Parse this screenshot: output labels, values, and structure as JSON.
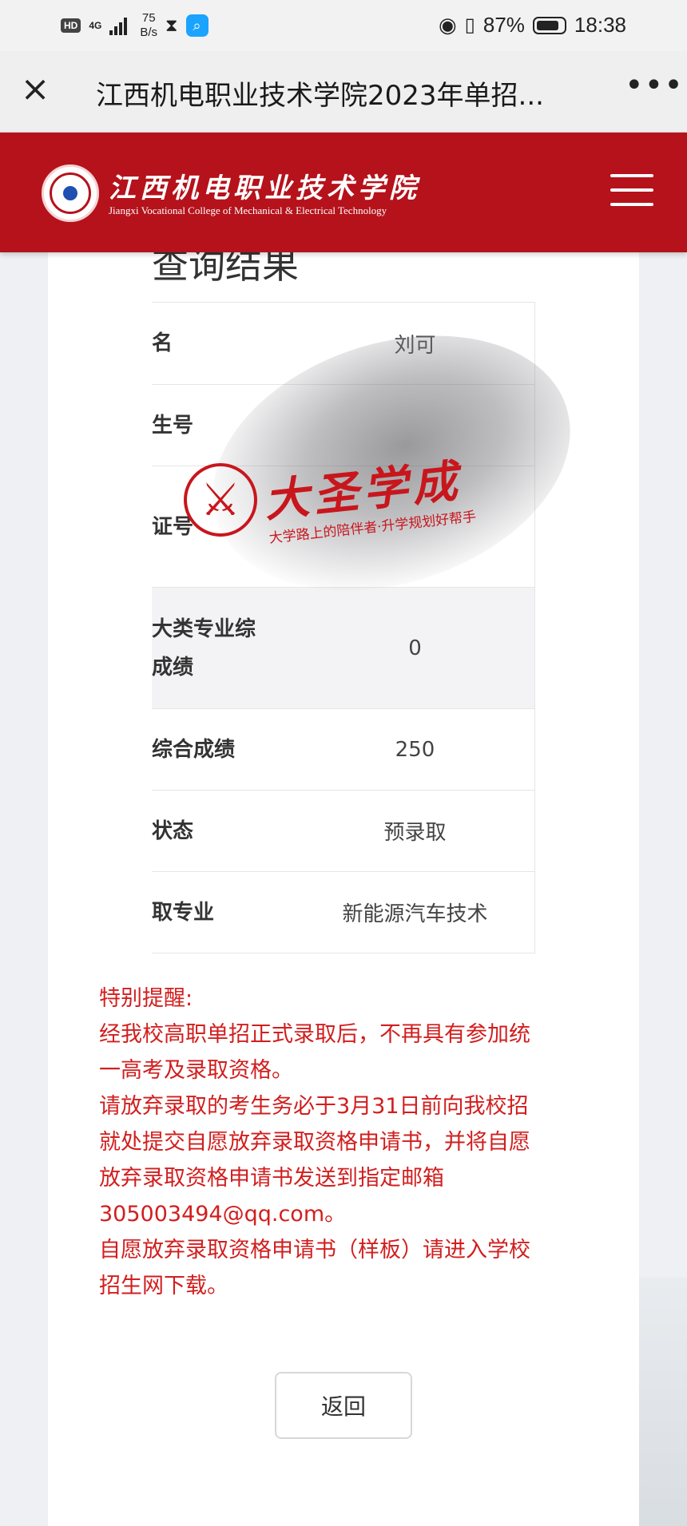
{
  "status_bar": {
    "hd": "HD",
    "network": "4G",
    "speed_value": "75",
    "speed_unit": "B/s",
    "battery": "87%",
    "time": "18:38",
    "icons": [
      "hd-badge",
      "signal-icon",
      "hourglass-icon",
      "search-app-icon",
      "eye-icon",
      "vibrate-icon",
      "battery-icon"
    ]
  },
  "nav": {
    "close_icon": "×",
    "title": "江西机电职业技术学院2023年单招...",
    "more_icon": "•••"
  },
  "header": {
    "school_name_cn": "江西机电职业技术学院",
    "school_name_en": "Jiangxi Vocational College of Mechanical & Electrical Technology",
    "brand_color": "#b5121b"
  },
  "result": {
    "title": "查询结果",
    "rows": [
      {
        "label": "名",
        "value": "刘可"
      },
      {
        "label": "生号",
        "value": ""
      },
      {
        "label": "证号",
        "value": ""
      },
      {
        "label_line1": "大类专业综",
        "label_line2": "成绩",
        "value": "0"
      },
      {
        "label": "综合成绩",
        "value": "250"
      },
      {
        "label": "状态",
        "value": "预录取"
      },
      {
        "label": "取专业",
        "value": "新能源汽车技术"
      }
    ]
  },
  "reminder": {
    "color": "#d21e1e",
    "heading": "特别提醒:",
    "line1": "经我校高职单招正式录取后，不再具有参加统",
    "line2": "一高考及录取资格。",
    "line3": "请放弃录取的考生务必于3月31日前向我校招",
    "line4": "就处提交自愿放弃录取资格申请书，并将自愿",
    "line5": "放弃录取资格申请书发送到指定邮箱",
    "line6": "305003494@qq.com。",
    "line7": "自愿放弃录取资格申请书（样板）请进入学校",
    "line8": "招生网下载。"
  },
  "back_button": {
    "label": "返回"
  },
  "watermark": {
    "brand": "大圣学成",
    "slogan": "大学路上的陪伴者·升学规划好帮手",
    "color": "#c8161d"
  }
}
